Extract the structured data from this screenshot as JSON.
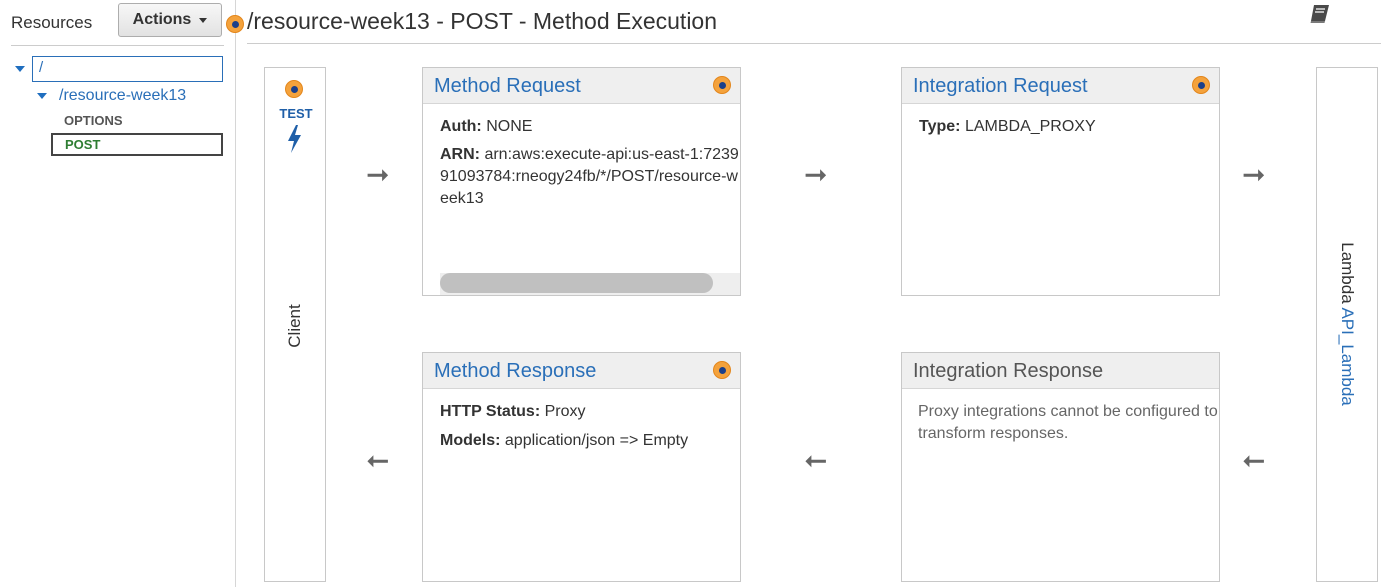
{
  "sidebar": {
    "title": "Resources",
    "actions_label": "Actions",
    "root_path": "/",
    "resource_path": "/resource-week13",
    "methods": [
      "OPTIONS",
      "POST"
    ]
  },
  "header": {
    "title": "/resource-week13 - POST - Method Execution"
  },
  "client": {
    "test_label": "TEST",
    "label": "Client"
  },
  "method_request": {
    "title": "Method Request",
    "auth_label": "Auth:",
    "auth_value": "NONE",
    "arn_label": "ARN:",
    "arn_value": "arn:aws:execute-api:us-east-1:723991093784:rneogy24fb/*/POST/resource-week13"
  },
  "integration_request": {
    "title": "Integration Request",
    "type_label": "Type:",
    "type_value": "LAMBDA_PROXY"
  },
  "method_response": {
    "title": "Method Response",
    "status_label": "HTTP Status:",
    "status_value": "Proxy",
    "models_label": "Models:",
    "models_value": "application/json => Empty"
  },
  "integration_response": {
    "title": "Integration Response",
    "note": "Proxy integrations cannot be configured to transform responses."
  },
  "backend": {
    "prefix": "Lambda",
    "function_name": "API_Lambda"
  },
  "icons": {
    "info": "info-dot-icon",
    "test": "lightning-bolt-icon",
    "docs": "book-icon",
    "arrow_right": "arrow-right-icon",
    "arrow_left": "arrow-left-icon"
  },
  "colors": {
    "link": "#2a6fb8",
    "post_method": "#2e7d32",
    "info_dot": "#f4a23c"
  }
}
